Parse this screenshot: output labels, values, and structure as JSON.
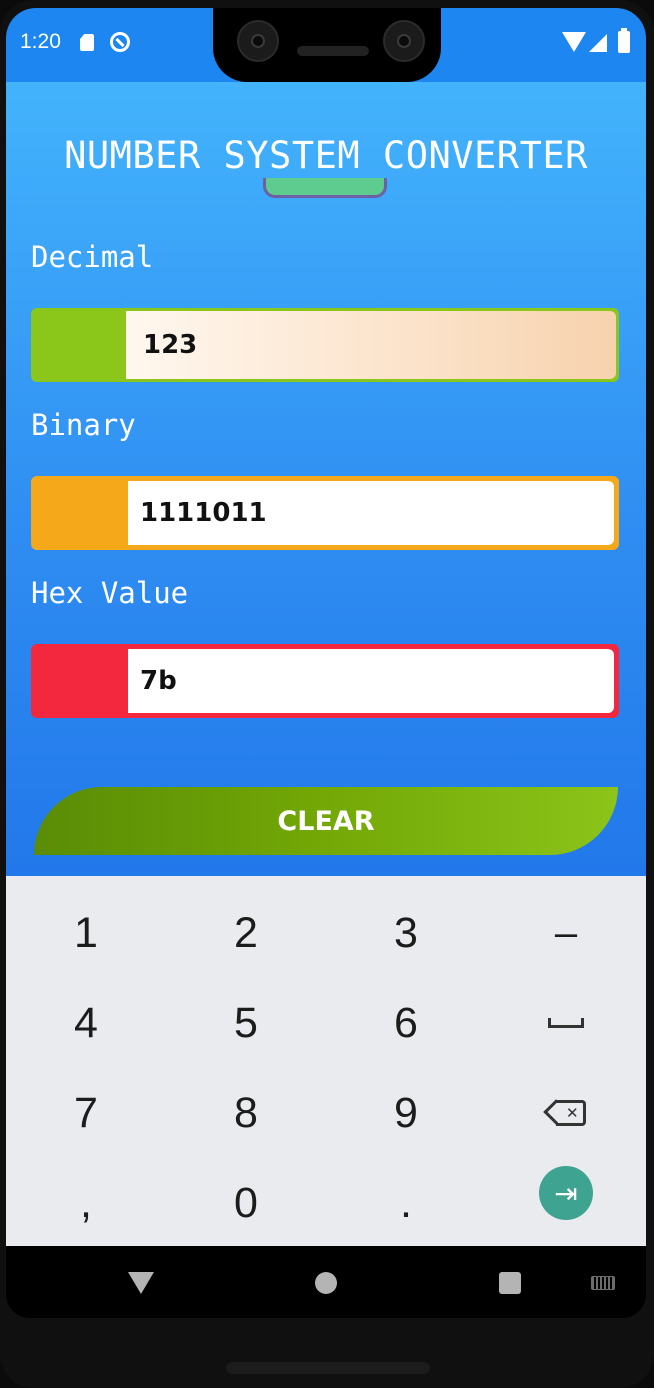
{
  "status_bar": {
    "time": "1:20",
    "icons": [
      "sd-card-icon",
      "do-not-disturb-icon",
      "wifi-icon",
      "signal-icon",
      "battery-icon"
    ]
  },
  "app": {
    "title": "NUMBER SYSTEM CONVERTER",
    "fields": {
      "decimal": {
        "label": "Decimal",
        "value": "123",
        "accent": "#8bc71a"
      },
      "binary": {
        "label": "Binary",
        "value": "1111011",
        "accent": "#f6a81b"
      },
      "hex": {
        "label": "Hex Value",
        "value": "7b",
        "accent": "#f3283f"
      }
    },
    "clear_label": "CLEAR"
  },
  "keyboard": {
    "row1": [
      "1",
      "2",
      "3",
      "–"
    ],
    "row2": [
      "4",
      "5",
      "6"
    ],
    "row3": [
      "7",
      "8",
      "9"
    ],
    "row4": [
      ",",
      "0",
      "."
    ],
    "special_keys": [
      "space-icon",
      "backspace-icon",
      "next-icon"
    ]
  },
  "nav_bar": {
    "icons": [
      "back-icon",
      "home-icon",
      "recents-icon",
      "keyboard-switch-icon"
    ]
  }
}
